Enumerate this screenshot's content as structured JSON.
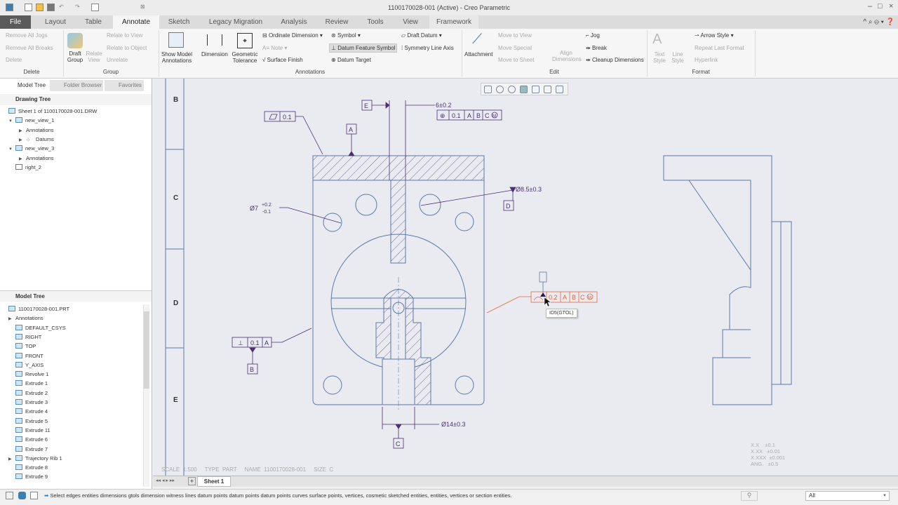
{
  "window": {
    "title": "1100170028-001 (Active) - Creo Parametric"
  },
  "menu_tabs": [
    "File",
    "Layout",
    "Table",
    "Annotate",
    "Sketch",
    "Legacy Migration",
    "Analysis",
    "Review",
    "Tools",
    "View",
    "Framework"
  ],
  "active_tab": "Annotate",
  "ribbon": {
    "delete_group": {
      "items": [
        "Remove All Jogs",
        "Remove All Breaks",
        "Delete"
      ],
      "label": "Delete"
    },
    "group_group": {
      "draft_group": "Draft Group",
      "relate_view": "Relate View",
      "items": [
        "Relate to View",
        "Relate to Object",
        "Unrelate"
      ],
      "label": "Group"
    },
    "annotations_group": {
      "show_model": "Show Model Annotations",
      "dimension": "Dimension",
      "geometric_tolerance": "Geometric Tolerance",
      "ordinate": "Ordinate Dimension",
      "note": "Note",
      "surface_finish": "Surface Finish",
      "symbol": "Symbol",
      "datum_feature": "Datum Feature Symbol",
      "datum_target": "Datum Target",
      "draft_datum": "Draft Datum",
      "symmetry": "Symmetry Line Axis",
      "label": "Annotations"
    },
    "edit_group": {
      "attachment": "Attachment",
      "move_to_view": "Move to View",
      "move_special": "Move Special",
      "move_to_sheet": "Move to Sheet",
      "align": "Align Dimensions",
      "jog": "Jog",
      "break": "Break",
      "cleanup": "Cleanup Dimensions",
      "label": "Edit"
    },
    "format_group": {
      "text_style": "Text Style",
      "line_style": "Line Style",
      "arrow_style": "Arrow Style",
      "repeat": "Repeat Last Format",
      "hyperlink": "Hyperlink",
      "label": "Format"
    }
  },
  "left_panel": {
    "tabs": [
      "Model Tree",
      "Folder Browser",
      "Favorites"
    ],
    "drawing_tree": {
      "title": "Drawing Tree",
      "items": [
        "Sheet 1 of 1100170028-001.DRW",
        "new_view_1",
        "Annotations",
        "Datums",
        "new_view_3",
        "Annotations",
        "right_2"
      ]
    },
    "model_tree": {
      "title": "Model Tree",
      "items": [
        "1100170028-001.PRT",
        "Annotations",
        "DEFAULT_CSYS",
        "RIGHT",
        "TOP",
        "FRONT",
        "Y_AXIS",
        "Revolve 1",
        "Extrude 1",
        "Extrude 2",
        "Extrude 3",
        "Extrude 4",
        "Extrude 5",
        "Extrude 11",
        "Extrude 6",
        "Extrude 7",
        "Trajectory Rib 1",
        "Extrude 8",
        "Extrude 9"
      ]
    }
  },
  "drawing": {
    "zones": [
      "B",
      "C",
      "D",
      "E"
    ],
    "datums": [
      "A",
      "B",
      "C",
      "D",
      "E"
    ],
    "flatness": {
      "value": "0.1"
    },
    "position_fcf": {
      "value": "0.1",
      "refs": [
        "A",
        "B",
        "C"
      ],
      "modifier": "M"
    },
    "dim_6": "6±0.2",
    "dim_7": "Ø7",
    "dim_7_upper": "+0.2",
    "dim_7_lower": "-0.1",
    "dim_85": "Ø8.5±0.3",
    "dim_14": "Ø14±0.3",
    "perp_fcf": {
      "value": "0.1",
      "ref": "A"
    },
    "profile_fcf": {
      "value": "0.2",
      "refs": [
        "A",
        "B",
        "C"
      ],
      "modifier": "M"
    },
    "tooltip": "ID5(GTOL)",
    "title_block": "SCALE  1.500     TYPE  PART     NAME  1100170028-001     SIZE  C",
    "tolerances": [
      "X.X    ±0.1",
      "X.XX   ±0.01",
      "X.XXX  ±0.001",
      "ANG.   ±0.5"
    ]
  },
  "sheet_tabs": [
    "Sheet 1"
  ],
  "status": {
    "message": "Select edges entities dimensions gtols dimension witness lines datum points datum points datum points curves surface points, vertices, cosmetic sketched entities, entities, vertices or section entities.",
    "filter": "All"
  },
  "colors": {
    "annotation": "#4a2f72",
    "selected": "#e0663a",
    "geometry": "#5b7aa8",
    "canvas": "#e9ebf1"
  }
}
